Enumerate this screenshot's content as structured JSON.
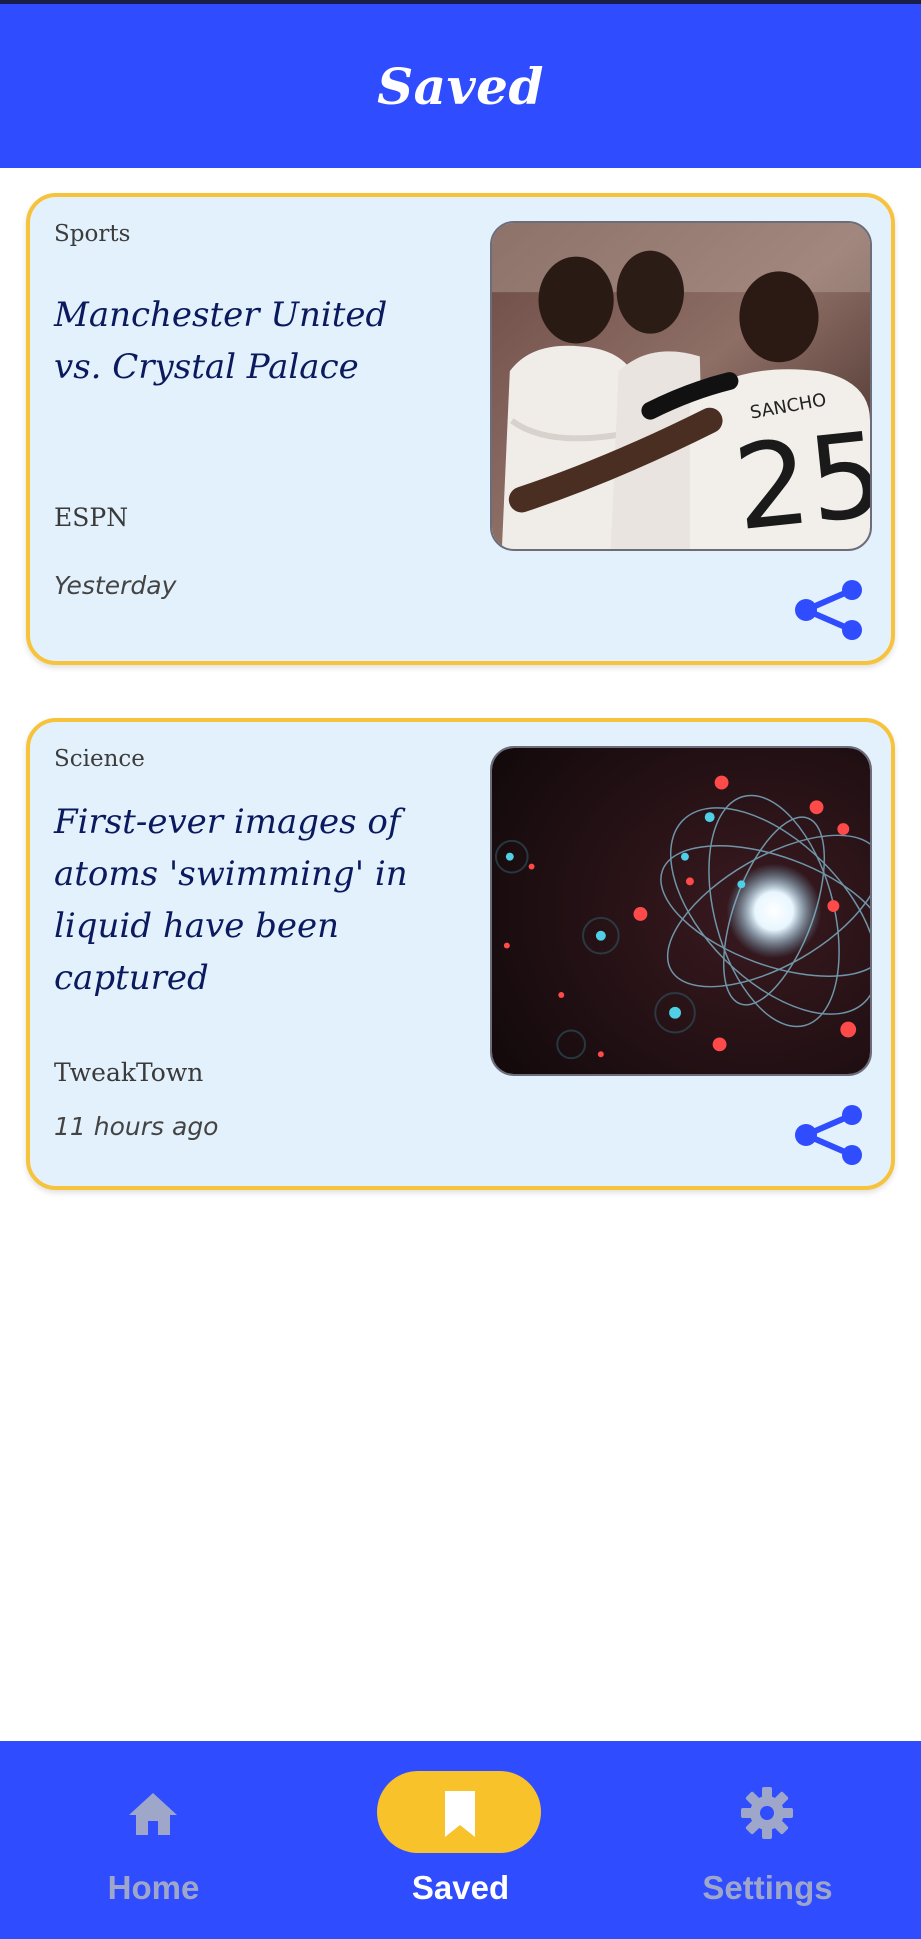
{
  "header": {
    "title": "Saved"
  },
  "articles": [
    {
      "category": "Sports",
      "headline": "Manchester United vs. Crystal Palace",
      "source": "ESPN",
      "time": "Yesterday",
      "jersey_name": "SANCHO",
      "jersey_number": "25",
      "share_icon": "share-icon"
    },
    {
      "category": "Science",
      "headline": "First-ever images of atoms 'swimming' in liquid have been captured",
      "source": "TweakTown",
      "time": "11 hours ago",
      "share_icon": "share-icon"
    }
  ],
  "bottom_nav": {
    "items": [
      {
        "label": "Home",
        "icon": "home-icon",
        "active": false
      },
      {
        "label": "Saved",
        "icon": "bookmark-icon",
        "active": true
      },
      {
        "label": "Settings",
        "icon": "gear-icon",
        "active": false
      }
    ]
  },
  "colors": {
    "primary": "#2f4cff",
    "accent": "#f8c22b",
    "card_background": "#e3f1fc",
    "card_border": "#f6c33a",
    "headline": "#0b1a5e"
  }
}
